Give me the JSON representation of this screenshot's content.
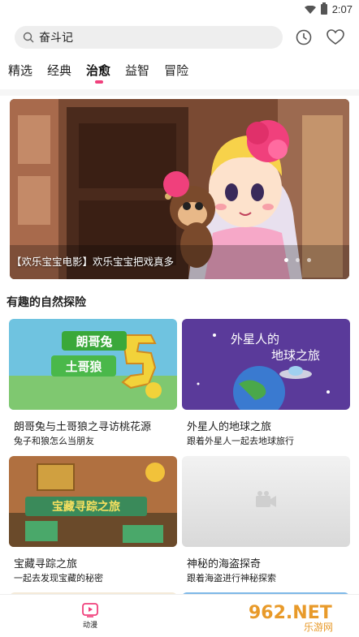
{
  "status_bar": {
    "time": "2:07"
  },
  "search": {
    "query": "奋斗记"
  },
  "tabs": [
    {
      "label": "精选"
    },
    {
      "label": "经典"
    },
    {
      "label": "治愈"
    },
    {
      "label": "益智"
    },
    {
      "label": "冒险"
    }
  ],
  "active_tab_index": 2,
  "banner": {
    "caption": "【欢乐宝宝电影】欢乐宝宝把戏真多",
    "dots": 3,
    "active_dot": 0
  },
  "section": {
    "title": "有趣的自然探险",
    "cards": [
      {
        "title": "朗哥兔与土哥狼之寻访桃花源",
        "subtitle": "兔子和狼怎么当朋友",
        "thumb_text": [
          "朗哥兔",
          "土哥狼"
        ]
      },
      {
        "title": "外星人的地球之旅",
        "subtitle": "跟着外星人一起去地球旅行",
        "thumb_text": [
          "外星人的",
          "地球之旅"
        ]
      },
      {
        "title": "宝藏寻踪之旅",
        "subtitle": "一起去发现宝藏的秘密",
        "thumb_text": [
          "宝藏寻踪之旅"
        ]
      },
      {
        "title": "神秘的海盗探奇",
        "subtitle": "跟着海盗进行神秘探索",
        "thumb_text": []
      }
    ]
  },
  "bottom_nav": {
    "label": "动漫"
  },
  "watermark": {
    "text": "962.NET",
    "sub": "乐游网"
  },
  "colors": {
    "accent": "#f0407c"
  }
}
